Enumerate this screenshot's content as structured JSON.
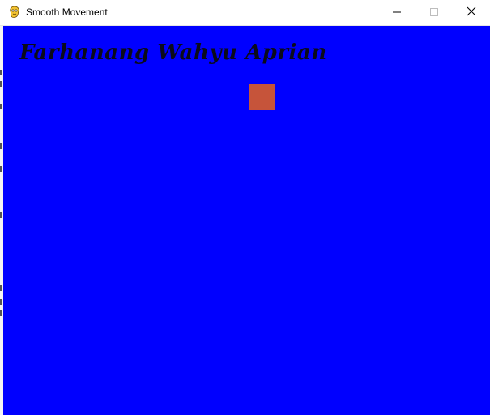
{
  "window": {
    "title": "Smooth Movement",
    "app_icon": "pygame-snake-icon",
    "controls": {
      "minimize_icon": "minimize-icon",
      "maximize_icon": "maximize-icon",
      "close_icon": "close-icon"
    }
  },
  "game": {
    "heading": "Farhanang Wahyu Aprian",
    "background_color": "#0000ff",
    "player_color": "#c6543a",
    "heading_color": "#0b0b1a"
  }
}
